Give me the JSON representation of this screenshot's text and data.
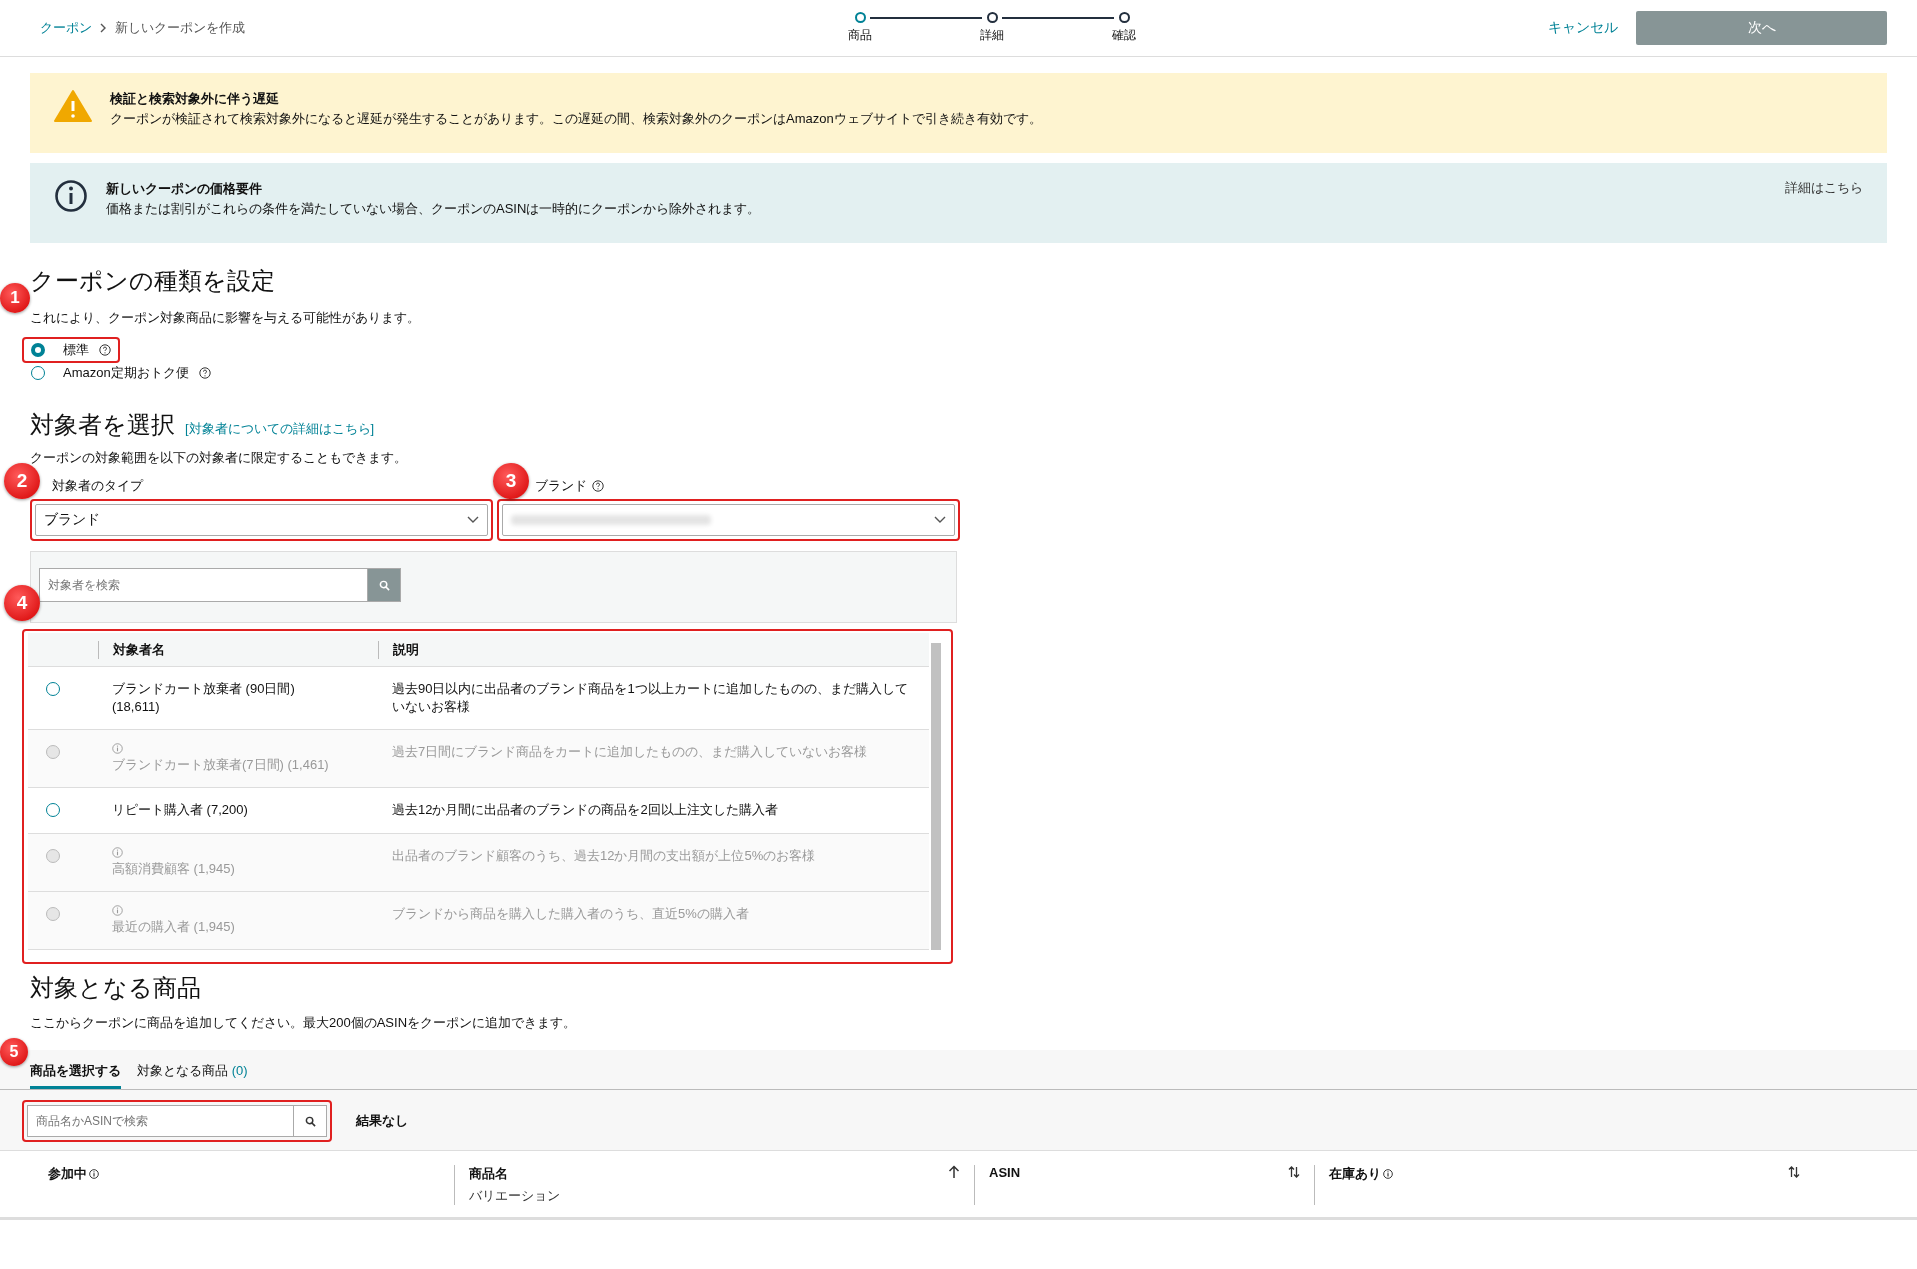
{
  "header": {
    "breadcrumbs": [
      {
        "label": "クーポン",
        "link": true
      },
      {
        "label": "新しいクーポンを作成",
        "link": false
      }
    ],
    "steps": [
      {
        "label": "商品",
        "selected": true
      },
      {
        "label": "詳細",
        "selected": false
      },
      {
        "label": "確認",
        "selected": false
      }
    ],
    "cancel": "キャンセル",
    "next": {
      "label": "次へ",
      "disabled": true
    }
  },
  "alerts": [
    {
      "kind": "warning",
      "title": "検証と検索対象外に伴う遅延",
      "body": "クーポンが検証されて検索対象外になると遅延が発生することがあります。この遅延の間、検索対象外のクーポンはAmazonウェブサイトで引き続き有効です。"
    },
    {
      "kind": "info",
      "title": "新しいクーポンの価格要件",
      "body": "価格または割引がこれらの条件を満たしていない場合、クーポンのASINは一時的にクーポンから除外されます。",
      "link": "詳細はこちら"
    }
  ],
  "coupon_type": {
    "title": "クーポンの種類を設定",
    "description": "これにより、クーポン対象商品に影響を与える可能性があります。",
    "options": [
      {
        "label": "標準",
        "selected": true
      },
      {
        "label": "Amazon定期おトク便",
        "selected": false
      }
    ]
  },
  "audience": {
    "title": "対象者を選択",
    "link": "[対象者についての詳細はこちら]",
    "description": "クーポンの対象範囲を以下の対象者に限定することもできます。",
    "type_field": {
      "label": "対象者のタイプ",
      "value": "ブランド"
    },
    "brand_field": {
      "label": "ブランド"
    },
    "search": {
      "placeholder": "対象者を検索"
    },
    "table": {
      "columns": [
        "対象者名",
        "説明"
      ],
      "rows": [
        {
          "name": "ブランドカート放棄者 (90日間) (18,611)",
          "description": "過去90日以内に出品者のブランド商品を1つ以上カートに追加したものの、まだ購入していないお客様",
          "disabled": false,
          "selected": false
        },
        {
          "name": "ブランドカート放棄者(7日間) (1,461)",
          "description": "過去7日間にブランド商品をカートに追加したものの、まだ購入していないお客様",
          "disabled": true,
          "selected": false
        },
        {
          "name": "リピート購入者 (7,200)",
          "description": "過去12か月間に出品者のブランドの商品を2回以上注文した購入者",
          "disabled": false,
          "selected": false
        },
        {
          "name": "高額消費顧客 (1,945)",
          "description": "出品者のブランド顧客のうち、過去12か月間の支出額が上位5%のお客様",
          "disabled": true,
          "selected": false
        },
        {
          "name": "最近の購入者 (1,945)",
          "description": "ブランドから商品を購入した購入者のうち、直近5%の購入者",
          "disabled": true,
          "selected": false
        }
      ]
    }
  },
  "products": {
    "title": "対象となる商品",
    "description": "ここからクーポンに商品を追加してください。最大200個のASINをクーポンに追加できます。",
    "tabs": [
      {
        "label": "商品を選択する",
        "selected": true
      },
      {
        "label": "対象となる商品",
        "count": "(0)",
        "selected": false
      }
    ],
    "search": {
      "placeholder": "商品名かASINで検索"
    },
    "result": "結果なし",
    "columns": [
      {
        "label": "参加中",
        "info": true
      },
      {
        "label": "商品名",
        "sublabel": "バリエーション",
        "sortable": true,
        "sorted": true
      },
      {
        "label": "ASIN",
        "sortable": true,
        "sorted": false
      },
      {
        "label": "在庫あり",
        "info": true,
        "sortable": true,
        "sorted": false
      }
    ]
  },
  "annotations": [
    "1",
    "2",
    "3",
    "4",
    "5"
  ]
}
